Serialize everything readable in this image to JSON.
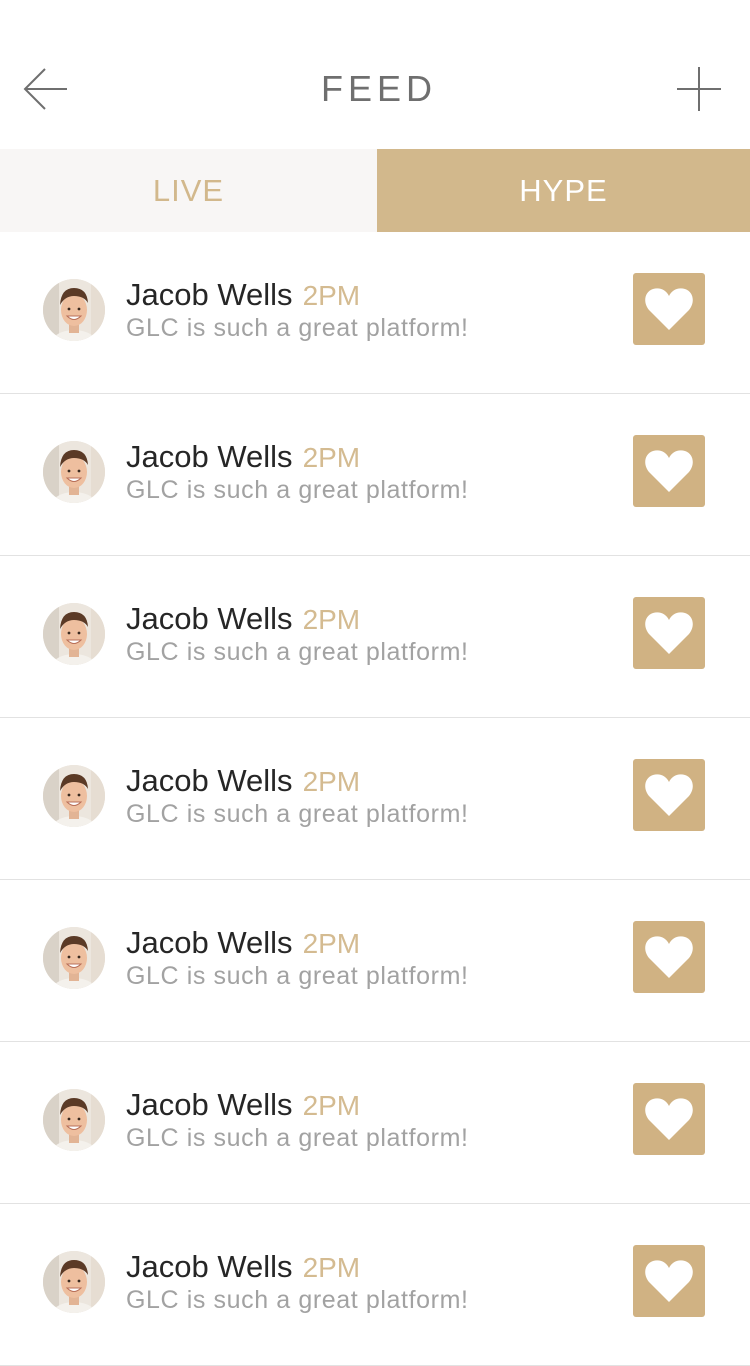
{
  "header": {
    "title": "FEED",
    "back_icon": "arrow-left-icon",
    "add_icon": "plus-icon"
  },
  "tabs": [
    {
      "label": "LIVE",
      "active": false
    },
    {
      "label": "HYPE",
      "active": true
    }
  ],
  "colors": {
    "accent": "#d0b283",
    "tab_inactive_bg": "#f8f6f5",
    "name_text": "#262626",
    "message_text": "#a2a2a2"
  },
  "feed": {
    "items": [
      {
        "name": "Jacob Wells",
        "time": "2PM",
        "message": "GLC is such a great platform!",
        "icon": "heart-icon"
      },
      {
        "name": "Jacob Wells",
        "time": "2PM",
        "message": "GLC is such a great platform!",
        "icon": "heart-icon"
      },
      {
        "name": "Jacob Wells",
        "time": "2PM",
        "message": "GLC is such a great platform!",
        "icon": "heart-icon"
      },
      {
        "name": "Jacob Wells",
        "time": "2PM",
        "message": "GLC is such a great platform!",
        "icon": "heart-icon"
      },
      {
        "name": "Jacob Wells",
        "time": "2PM",
        "message": "GLC is such a great platform!",
        "icon": "heart-icon"
      },
      {
        "name": "Jacob Wells",
        "time": "2PM",
        "message": "GLC is such a great platform!",
        "icon": "heart-icon"
      },
      {
        "name": "Jacob Wells",
        "time": "2PM",
        "message": "GLC is such a great platform!",
        "icon": "heart-icon"
      }
    ]
  }
}
